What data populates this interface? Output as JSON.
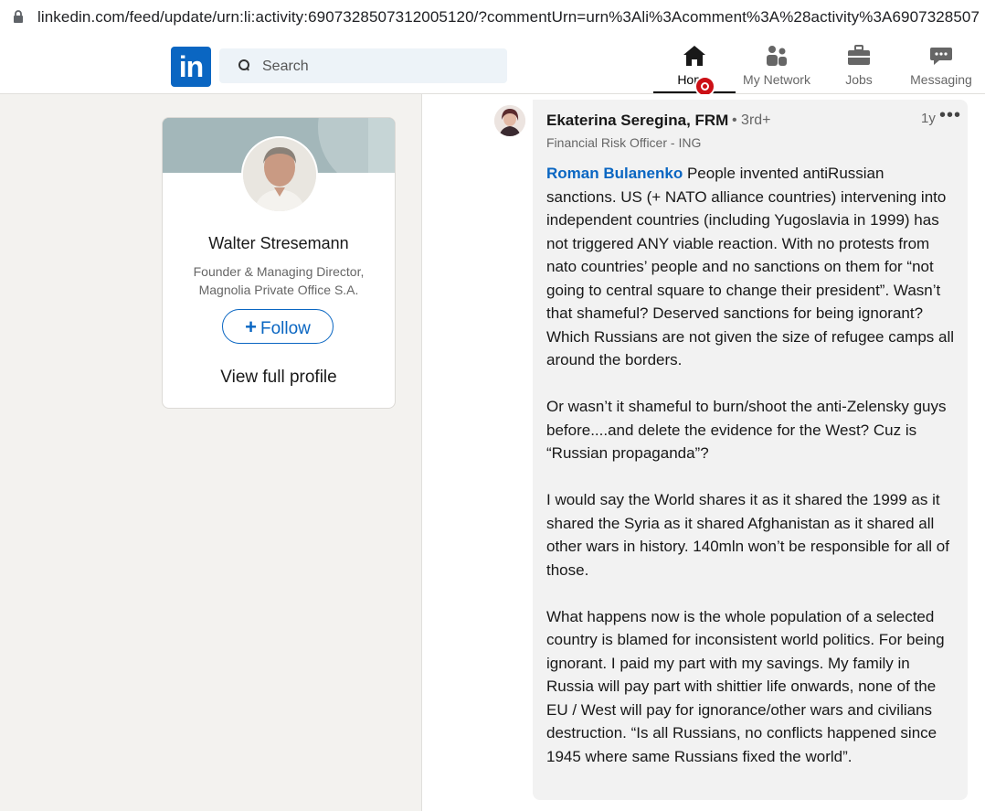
{
  "browser": {
    "url": "linkedin.com/feed/update/urn:li:activity:6907328507312005120/?commentUrn=urn%3Ali%3Acomment%3A%28activity%3A6907328507"
  },
  "header": {
    "logo_text": "in",
    "search_placeholder": "Search",
    "nav": {
      "home": "Home",
      "network": "My Network",
      "jobs": "Jobs",
      "messaging": "Messaging"
    },
    "accent": "#0a66c2"
  },
  "profile_card": {
    "name": "Walter Stresemann",
    "headline": "Founder & Managing Director, Magnolia Private Office S.A.",
    "follow_plus": "+",
    "follow_label": "Follow",
    "view_profile": "View full profile"
  },
  "comment": {
    "author": "Ekaterina Seregina, FRM",
    "degree": "• 3rd+",
    "time": "1y",
    "more": "•••",
    "headline": "Financial Risk Officer - ING",
    "mention": "Roman Bulanenko",
    "p1_rest": " People invented antiRussian sanctions. US (+ NATO alliance countries) intervening into independent countries (including Yugoslavia in 1999) has not triggered ANY viable reaction. With no protests from nato countries’ people and no sanctions on them for “not going to central square to change their president”. Wasn’t that shameful? Deserved sanctions for being ignorant? Which Russians are not given the size of refugee camps all around the borders.",
    "p2": "Or wasn’t it shameful to burn/shoot the anti-Zelensky guys before....and delete the evidence for the West? Cuz is “Russian propaganda”?",
    "p3": "I would say the World shares it as it shared the 1999 as it shared the Syria as it shared Afghanistan as it shared all other wars in history. 140mln won’t be responsible for all of those.",
    "p4": "What happens now is the whole population of a selected country is blamed for inconsistent world politics. For being ignorant. I paid my part with my savings. My family in Russia will pay part with shittier life onwards, none of the EU / West will pay for ignorance/other wars and civilians destruction. “Is all Russians, no conflicts happened since 1945 where same Russians fixed the world”."
  }
}
